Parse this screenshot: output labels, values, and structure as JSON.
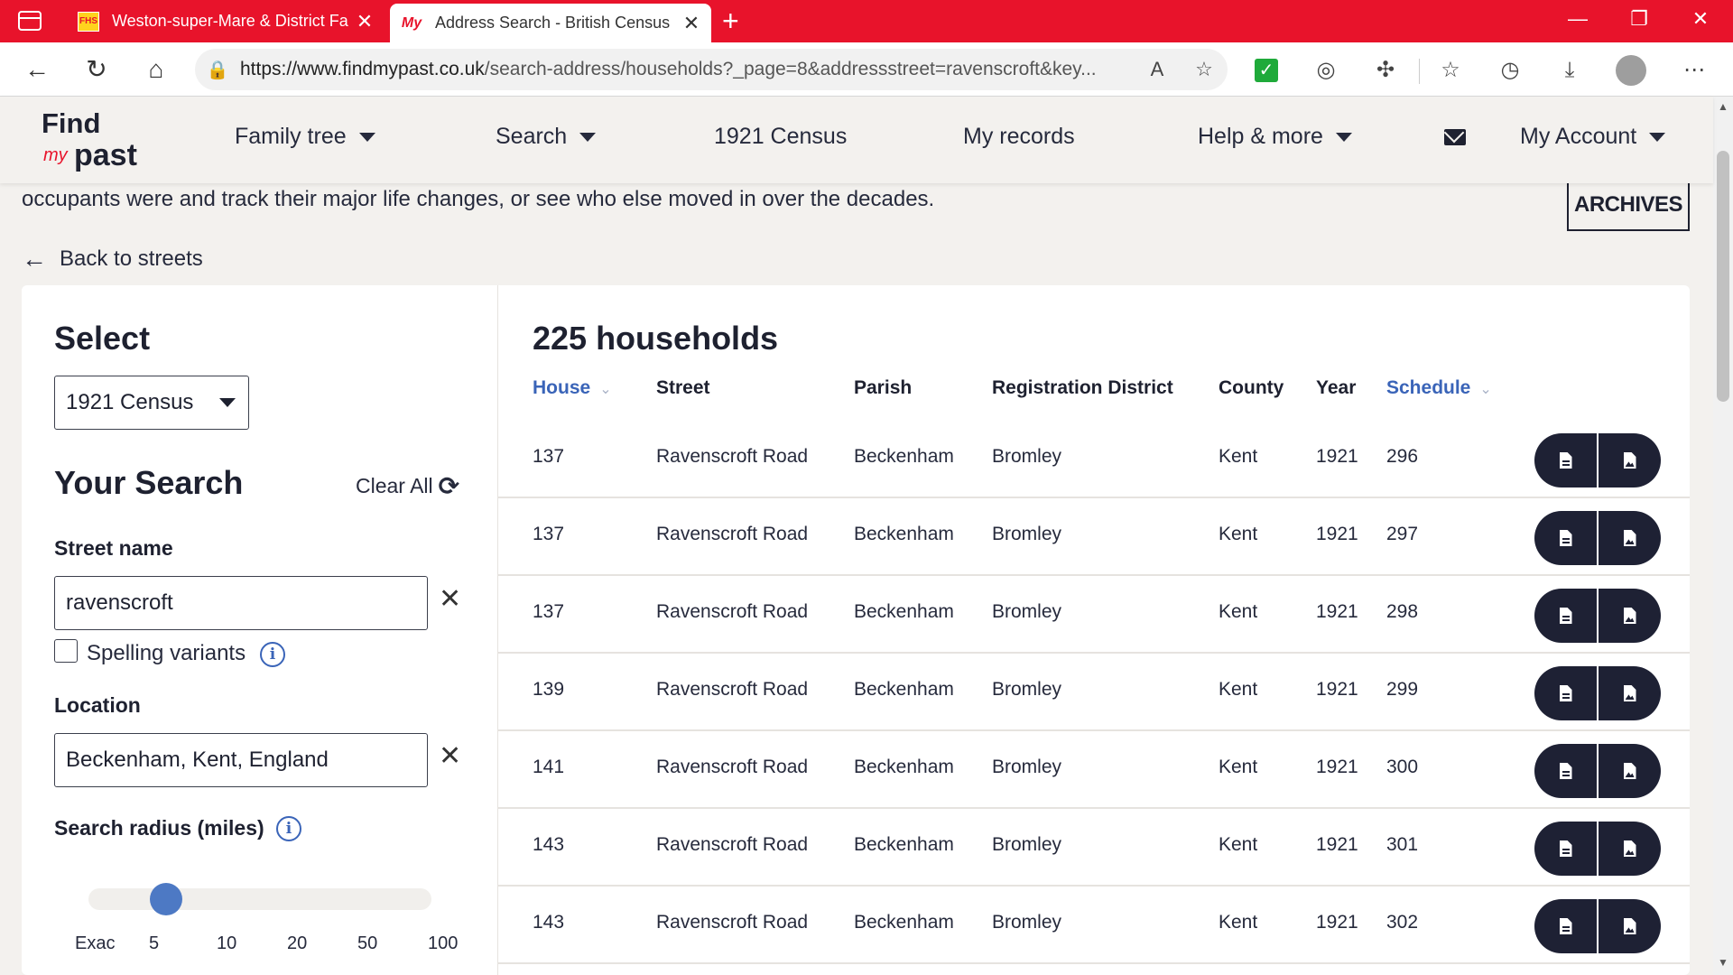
{
  "browser": {
    "tabs": [
      {
        "favicon": "FHS",
        "title": "Weston-super-Mare & District Family History Society"
      },
      {
        "favicon": "My",
        "title": "Address Search - British Census Records"
      }
    ],
    "url_host": "https://www.findmypast.co.uk",
    "url_path": "/search-address/households?_page=8&addressstreet=ravenscroft&key..."
  },
  "site": {
    "logo": {
      "find": "Find",
      "my": "my",
      "past": "past"
    },
    "nav": {
      "family_tree": "Family tree",
      "search": "Search",
      "census": "1921 Census",
      "my_records": "My records",
      "help": "Help & more",
      "account": "My Account"
    }
  },
  "intro_text": "occupants were and track their major life changes, or see who else moved in over the decades.",
  "archives_label": "ARCHIVES",
  "back_label": "Back to streets",
  "filters": {
    "select_heading": "Select",
    "dataset": "1921 Census",
    "your_search": "Your Search",
    "clear_all": "Clear All",
    "street_label": "Street name",
    "street_value": "ravenscroft",
    "spelling_variants": "Spelling variants",
    "spelling_checked": false,
    "location_label": "Location",
    "location_value": "Beckenham, Kent, England",
    "radius_label": "Search radius (miles)",
    "radius_options": [
      "Exac",
      "5",
      "10",
      "20",
      "50",
      "100"
    ],
    "radius_selected": "5"
  },
  "results": {
    "heading": "225 households",
    "columns": {
      "house": "House",
      "street": "Street",
      "parish": "Parish",
      "district": "Registration District",
      "county": "County",
      "year": "Year",
      "schedule": "Schedule"
    },
    "rows": [
      {
        "house": "137",
        "street": "Ravenscroft Road",
        "parish": "Beckenham",
        "district": "Bromley",
        "county": "Kent",
        "year": "1921",
        "schedule": "296"
      },
      {
        "house": "137",
        "street": "Ravenscroft Road",
        "parish": "Beckenham",
        "district": "Bromley",
        "county": "Kent",
        "year": "1921",
        "schedule": "297"
      },
      {
        "house": "137",
        "street": "Ravenscroft Road",
        "parish": "Beckenham",
        "district": "Bromley",
        "county": "Kent",
        "year": "1921",
        "schedule": "298"
      },
      {
        "house": "139",
        "street": "Ravenscroft Road",
        "parish": "Beckenham",
        "district": "Bromley",
        "county": "Kent",
        "year": "1921",
        "schedule": "299"
      },
      {
        "house": "141",
        "street": "Ravenscroft Road",
        "parish": "Beckenham",
        "district": "Bromley",
        "county": "Kent",
        "year": "1921",
        "schedule": "300"
      },
      {
        "house": "143",
        "street": "Ravenscroft Road",
        "parish": "Beckenham",
        "district": "Bromley",
        "county": "Kent",
        "year": "1921",
        "schedule": "301"
      },
      {
        "house": "143",
        "street": "Ravenscroft Road",
        "parish": "Beckenham",
        "district": "Bromley",
        "county": "Kent",
        "year": "1921",
        "schedule": "302"
      }
    ]
  },
  "colors": {
    "brand_red": "#e8132b",
    "navy": "#1e2130",
    "link_blue": "#3a64b8",
    "page_bg": "#f3f1ee"
  }
}
